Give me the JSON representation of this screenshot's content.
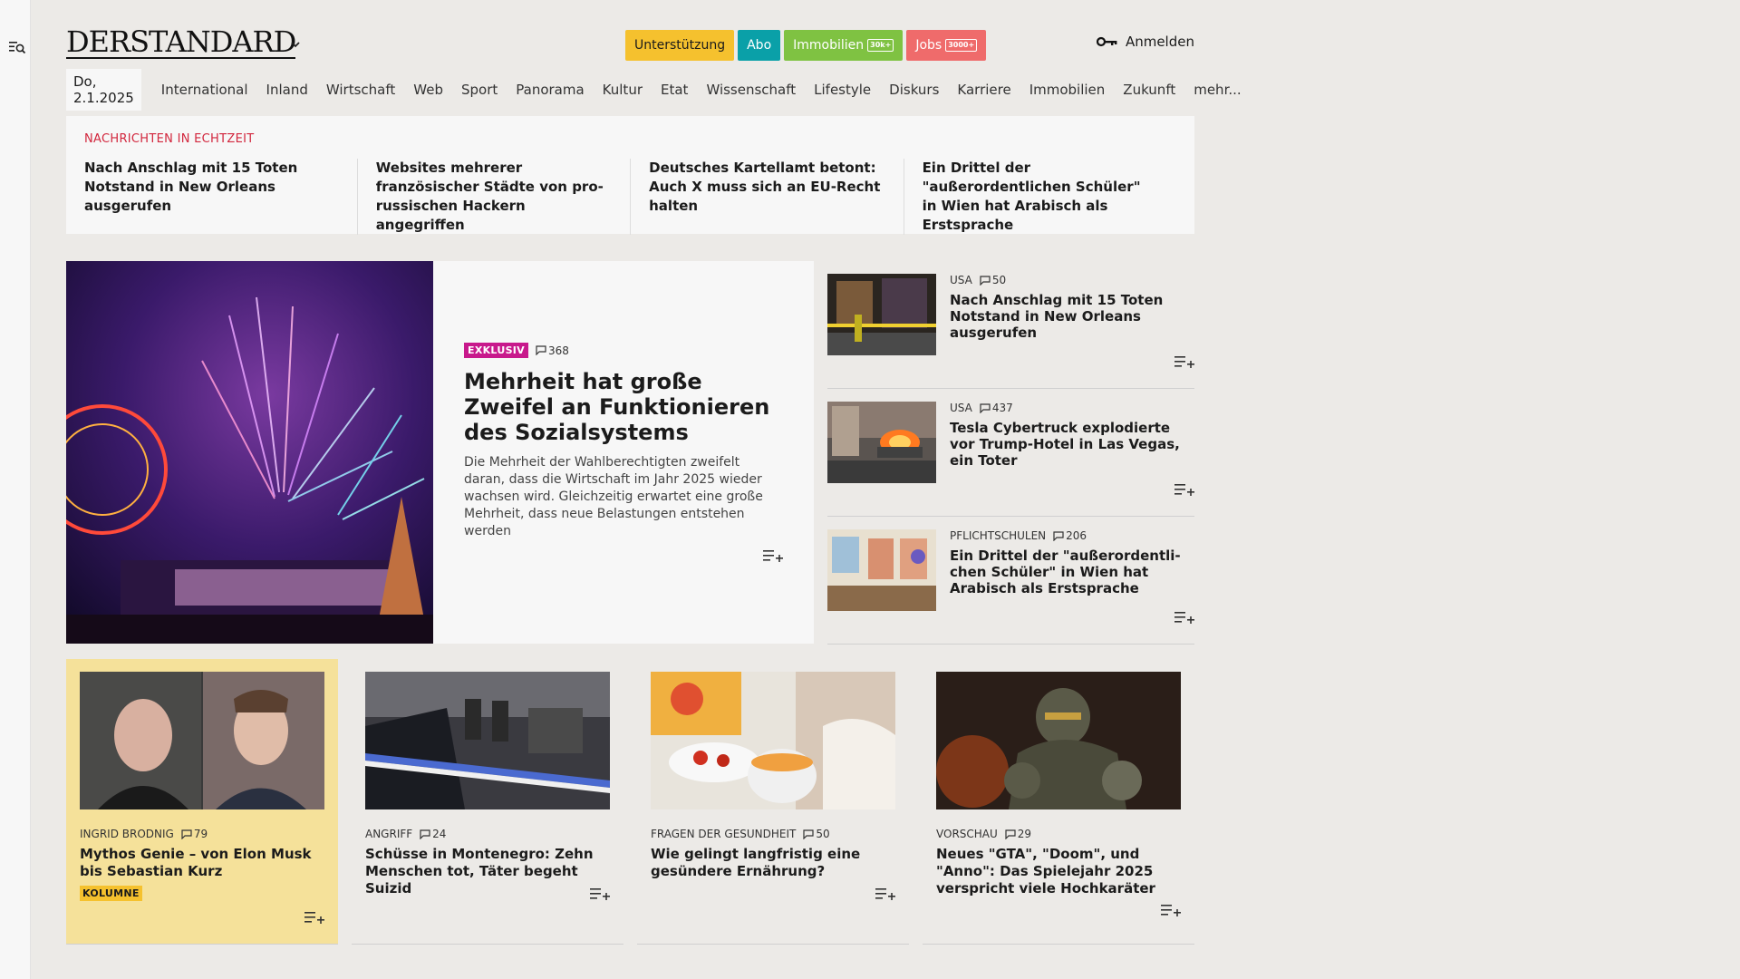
{
  "header": {
    "logo": "DERSTANDARD",
    "pills": [
      {
        "label": "Unterstützung",
        "tag": ""
      },
      {
        "label": "Abo",
        "tag": ""
      },
      {
        "label": "Immobilien",
        "tag": "30k+"
      },
      {
        "label": "Jobs",
        "tag": "3000+"
      }
    ],
    "login": "Anmelden"
  },
  "nav": {
    "date": "Do, 2.1.2025",
    "items": [
      "International",
      "Inland",
      "Wirtschaft",
      "Web",
      "Sport",
      "Panorama",
      "Kultur",
      "Etat",
      "Wissenschaft",
      "Lifestyle",
      "Diskurs",
      "Karriere",
      "Immobilien",
      "Zukunft",
      "mehr..."
    ]
  },
  "breaking": {
    "heading": "NACHRICHTEN IN ECHTZEIT",
    "items": [
      "Nach Anschlag mit 15 Toten Notstand in New Orleans ausgerufen",
      "Websites mehrerer französischer Städte von pro-russischen Hackern angegriffen",
      "Deutsches Kartellamt betont: Auch X muss sich an EU-Recht halten",
      "Ein Drittel der \"außerordentlichen Schüler\" in Wien hat Arabisch als Erstsprache"
    ]
  },
  "lead": {
    "badge": "EXKLUSIV",
    "comments": "368",
    "title": "Mehrheit hat große Zweifel an Funktionieren des Sozialsystems",
    "teaser": "Die Mehrheit der Wahlberechtigten zweifelt daran, dass die Wirtschaft im Jahr 2025 wieder wachsen wird. Gleichzeitig erwartet eine große Mehrheit, dass neue Belastungen entstehen werden"
  },
  "side": [
    {
      "kicker": "USA",
      "comments": "50",
      "title": "Nach Anschlag mit 15 Toten Notstand in New Orleans ausgerufen"
    },
    {
      "kicker": "USA",
      "comments": "437",
      "title": "Tesla Cybertruck explodierte vor Trump-Hotel in Las Vegas, ein Toter"
    },
    {
      "kicker": "PFLICHTSCHULEN",
      "comments": "206",
      "title": "Ein Drittel der \"außerordentli-chen Schüler\" in Wien hat Arabisch als Erstsprache"
    }
  ],
  "bottom": [
    {
      "kicker": "INGRID BRODNIG",
      "comments": "79",
      "title": "Mythos Genie – von Elon Musk bis Sebastian Kurz",
      "tag": "KOLUMNE"
    },
    {
      "kicker": "ANGRIFF",
      "comments": "24",
      "title": "Schüsse in Montenegro: Zehn Menschen tot, Täter begeht Suizid",
      "tag": ""
    },
    {
      "kicker": "FRAGEN DER GESUNDHEIT",
      "comments": "50",
      "title": "Wie gelingt langfristig eine gesündere Ernährung?",
      "tag": ""
    },
    {
      "kicker": "VORSCHAU",
      "comments": "29",
      "title": "Neues \"GTA\", \"Doom\", und \"Anno\": Das Spielejahr 2025 verspricht viele Hochkaräter",
      "tag": ""
    }
  ],
  "colors": {
    "accent_red": "#d2263d",
    "exklusiv": "#c8198c",
    "kolumne_bg": "#f5e19a"
  }
}
